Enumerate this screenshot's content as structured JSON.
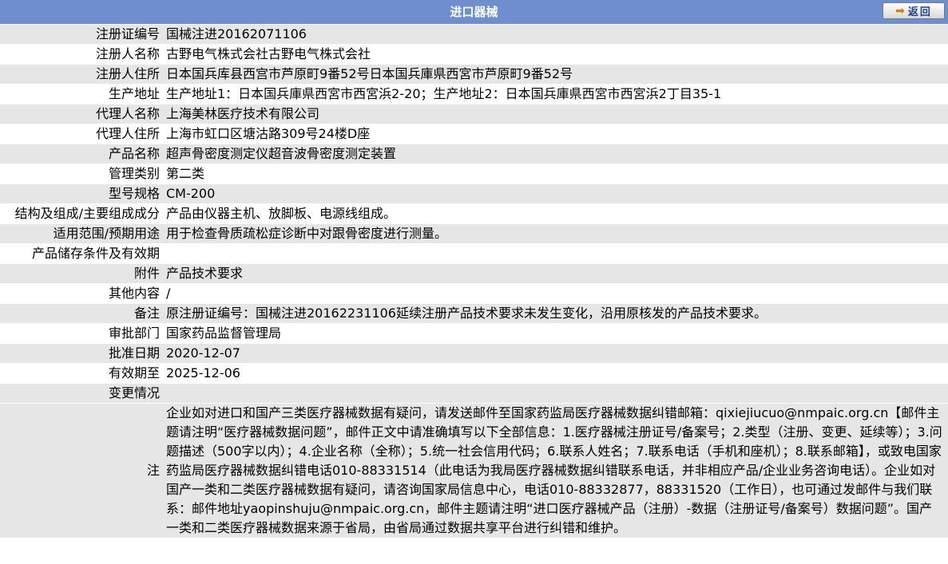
{
  "header": {
    "title": "进口器械",
    "back_label": "返回",
    "back_icon": "arrow-right-icon"
  },
  "fields": [
    {
      "label": "注册证编号",
      "value": "国械注进20162071106"
    },
    {
      "label": "注册人名称",
      "value": "古野电气株式会社古野电气株式会社"
    },
    {
      "label": "注册人住所",
      "value": "日本国兵库县西宫市芦原町9番52号日本国兵庫県西宮市芦原町9番52号"
    },
    {
      "label": "生产地址",
      "value": "生产地址1：日本国兵庫県西宮市西宮浜2-20；生产地址2：日本国兵庫県西宮市西宮浜2丁目35-1"
    },
    {
      "label": "代理人名称",
      "value": "上海美林医疗技术有限公司"
    },
    {
      "label": "代理人住所",
      "value": "上海市虹口区塘沽路309号24楼D座"
    },
    {
      "label": "产品名称",
      "value": "超声骨密度测定仪超音波骨密度测定装置"
    },
    {
      "label": "管理类别",
      "value": "第二类"
    },
    {
      "label": "型号规格",
      "value": "CM-200"
    },
    {
      "label": "结构及组成/主要组成成分",
      "value": "产品由仪器主机、放脚板、电源线组成。"
    },
    {
      "label": "适用范围/预期用途",
      "value": "用于检查骨质疏松症诊断中对跟骨密度进行测量。"
    },
    {
      "label": "产品储存条件及有效期",
      "value": ""
    },
    {
      "label": "附件",
      "value": "产品技术要求"
    },
    {
      "label": "其他内容",
      "value": "/"
    },
    {
      "label": "备注",
      "value": "原注册证编号：国械注进20162231106延续注册产品技术要求未发生变化，沿用原核发的产品技术要求。"
    },
    {
      "label": "审批部门",
      "value": "国家药品监督管理局"
    },
    {
      "label": "批准日期",
      "value": "2020-12-07"
    },
    {
      "label": "有效期至",
      "value": "2025-12-06"
    },
    {
      "label": "变更情况",
      "value": ""
    }
  ],
  "notice": {
    "label": "注",
    "text": "企业如对进口和国产三类医疗器械数据有疑问，请发送邮件至国家药监局医疗器械数据纠错邮箱：qixiejiucuo@nmpaic.org.cn【邮件主题请注明“医疗器械数据问题”，邮件正文中请准确填写以下全部信息：1.医疗器械注册证号/备案号；2.类型（注册、变更、延续等）；3.问题描述（500字以内）；4.企业名称（全称）；5.统一社会信用代码；6.联系人姓名；7.联系电话（手机和座机）；8.联系邮箱】，或致电国家药监局医疗器械数据纠错电话010-88331514（此电话为我局医疗器械数据纠错联系电话，并非相应产品/企业业务咨询电话）。企业如对国产一类和二类医疗器械数据有疑问，请咨询国家局信息中心，电话010-88332877，88331520（工作日），也可通过发邮件与我们联系：邮件地址yaopinshuju@nmpaic.org.cn，邮件主题请注明“进口医疗器械产品（注册）-数据（注册证号/备案号）数据问题”。国产一类和二类医疗器械数据来源于省局，由省局通过数据共享平台进行纠错和维护。"
  }
}
